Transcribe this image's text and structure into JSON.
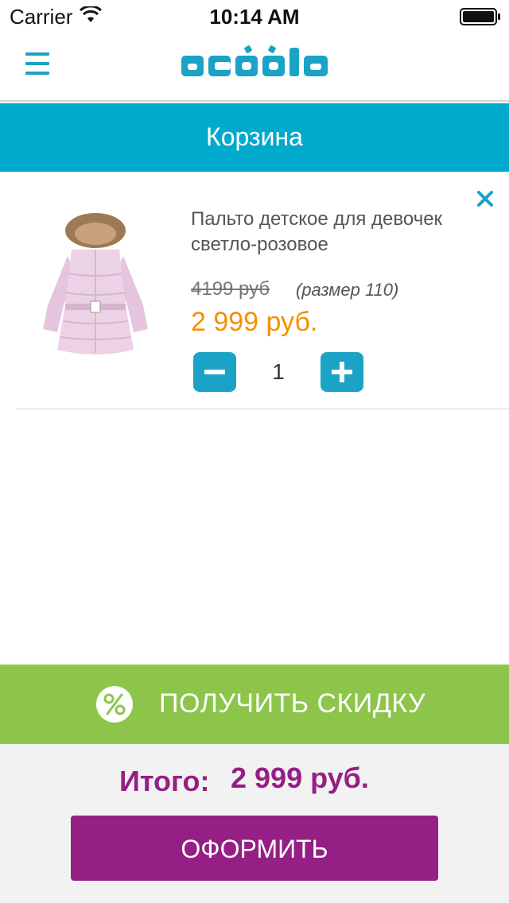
{
  "status_bar": {
    "carrier": "Carrier",
    "time": "10:14 AM"
  },
  "header": {
    "logo_text": "acoola",
    "brand_color": "#1aa3c6"
  },
  "title_bar": {
    "title": "Корзина",
    "color": "#00aacc"
  },
  "cart": {
    "items": [
      {
        "name": "Пальто детское для девочек светло-розовое",
        "old_price": "4199 руб",
        "size": "(размер 110)",
        "price": "2 999 руб.",
        "quantity": "1"
      }
    ]
  },
  "discount": {
    "label": "ПОЛУЧИТЬ СКИДКУ",
    "color": "#8dc54b",
    "icon": "percent-icon"
  },
  "footer": {
    "total_label": "Итого:",
    "total_value": "2 999 руб.",
    "checkout_label": "ОФОРМИТЬ",
    "accent_color": "#951f85"
  }
}
